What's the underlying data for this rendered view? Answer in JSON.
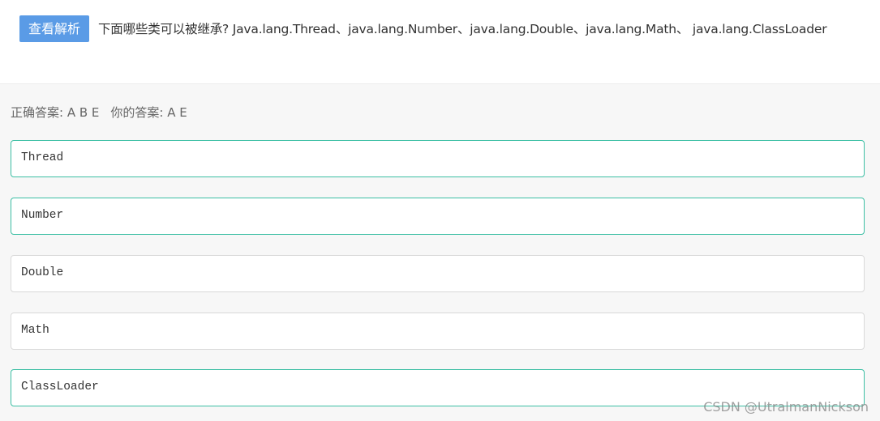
{
  "header": {
    "analysis_button_label": "查看解析",
    "question_text": "下面哪些类可以被继承?   Java.lang.Thread、java.lang.Number、java.lang.Double、java.lang.Math、 java.lang.ClassLoader"
  },
  "result": {
    "correct_answer_text": "正确答案: A B E",
    "your_answer_text": "你的答案: A E"
  },
  "options": [
    {
      "label": "Thread",
      "correct": true
    },
    {
      "label": "Number",
      "correct": true
    },
    {
      "label": "Double",
      "correct": false
    },
    {
      "label": "Math",
      "correct": false
    },
    {
      "label": "ClassLoader",
      "correct": true
    }
  ],
  "colors": {
    "button_bg": "#5a9be6",
    "correct_border": "#3cbfa4",
    "default_border": "#d9d9d9"
  },
  "watermark": "CSDN @UtralmanNickson"
}
